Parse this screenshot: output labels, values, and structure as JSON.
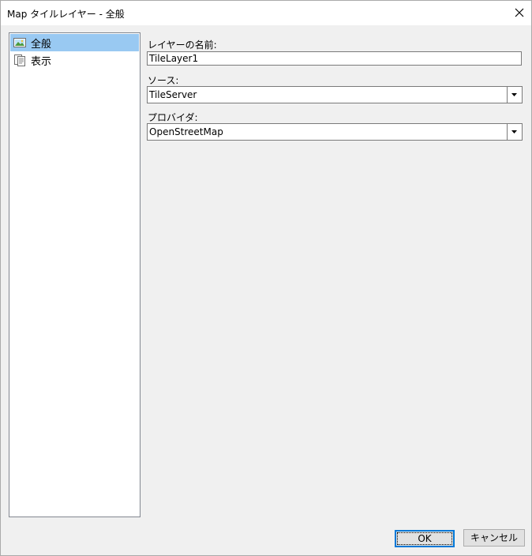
{
  "window": {
    "title": "Map タイルレイヤー - 全般"
  },
  "nav": {
    "items": [
      {
        "label": "全般",
        "icon": "image-icon",
        "selected": true
      },
      {
        "label": "表示",
        "icon": "display-settings-icon",
        "selected": false
      }
    ]
  },
  "form": {
    "layer_name_label": "レイヤーの名前:",
    "layer_name_value": "TileLayer1",
    "source_label": "ソース:",
    "source_value": "TileServer",
    "provider_label": "プロバイダ:",
    "provider_value": "OpenStreetMap"
  },
  "buttons": {
    "ok_label": "OK",
    "cancel_label": "キャンセル"
  },
  "colors": {
    "selection": "#99c9f2",
    "default_button_border": "#0078d7",
    "background": "#f0f0f0"
  }
}
